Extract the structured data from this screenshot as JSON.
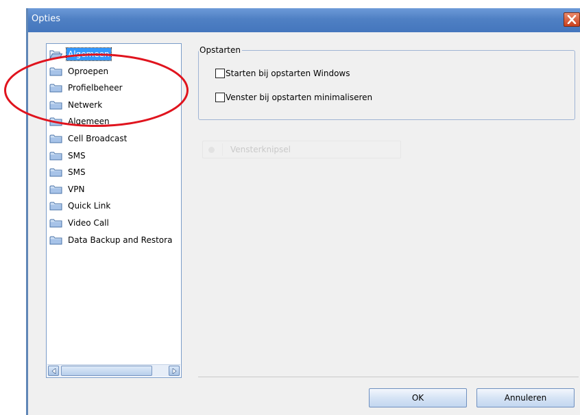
{
  "window": {
    "title": "Opties",
    "close_icon": "close-icon"
  },
  "tree": {
    "selected_index": 0,
    "items": [
      {
        "label": "Algemeen",
        "icon": "folder-open-icon"
      },
      {
        "label": "Oproepen",
        "icon": "folder-icon"
      },
      {
        "label": "Profielbeheer",
        "icon": "folder-icon"
      },
      {
        "label": "Netwerk",
        "icon": "folder-icon"
      },
      {
        "label": "Algemeen",
        "icon": "folder-icon"
      },
      {
        "label": "Cell Broadcast",
        "icon": "folder-icon"
      },
      {
        "label": "SMS",
        "icon": "folder-icon"
      },
      {
        "label": "SMS",
        "icon": "folder-icon"
      },
      {
        "label": "VPN",
        "icon": "folder-icon"
      },
      {
        "label": "Quick Link",
        "icon": "folder-icon"
      },
      {
        "label": "Video Call",
        "icon": "folder-icon"
      },
      {
        "label": "Data Backup and Restora",
        "icon": "folder-icon"
      }
    ]
  },
  "startup_group": {
    "title": "Opstarten",
    "options": [
      {
        "label": "Starten bij opstarten Windows",
        "checked": false
      },
      {
        "label": "Venster bij opstarten minimaliseren",
        "checked": false
      }
    ]
  },
  "disabled_option": {
    "label": "Vensterknipsel",
    "enabled": false
  },
  "buttons": {
    "ok": "OK",
    "cancel": "Annuleren"
  },
  "colors": {
    "titlebar": "#4f80c4",
    "selection": "#3399ff",
    "annotation": "#e0141e",
    "close_button": "#c9401e"
  }
}
